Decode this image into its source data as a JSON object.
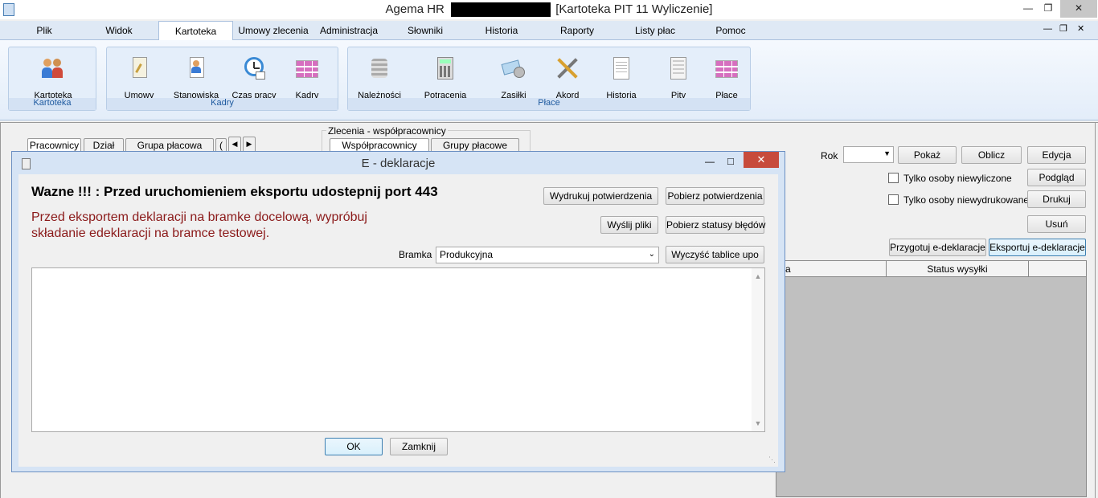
{
  "window": {
    "title": "Agema HR              [Kartoteka PIT 11 Wyliczenie]",
    "title_prefix": "Agema HR",
    "title_suffix": "[Kartoteka PIT 11 Wyliczenie]"
  },
  "menu": {
    "tabs": [
      "Plik",
      "Widok",
      "Kartoteka",
      "Umowy zlecenia",
      "Administracja",
      "Słowniki",
      "Historia",
      "Raporty",
      "Listy płac",
      "Pomoc"
    ],
    "active": "Kartoteka"
  },
  "ribbon": {
    "groups": [
      {
        "label": "Kartoteka",
        "buttons": [
          {
            "label": "Kartoteka",
            "icon": "people-icon"
          }
        ]
      },
      {
        "label": "Kadry",
        "buttons": [
          {
            "label": "Umowy",
            "icon": "contract-icon"
          },
          {
            "label": "Stanowiska",
            "icon": "person-doc-icon"
          },
          {
            "label": "Czas pracy",
            "icon": "clock-icon"
          },
          {
            "label": "Kadry",
            "icon": "grid-icon"
          }
        ]
      },
      {
        "label": "Płace",
        "buttons": [
          {
            "label": "Należności",
            "icon": "coins-icon"
          },
          {
            "label": "Potrącenia",
            "icon": "calculator-icon"
          },
          {
            "label": "Zasiłki",
            "icon": "money-icon"
          },
          {
            "label": "Akord",
            "icon": "tools-icon"
          },
          {
            "label": "Historia",
            "icon": "document-icon"
          },
          {
            "label": "Pity",
            "icon": "form-icon"
          },
          {
            "label": "Płace",
            "icon": "grid-icon"
          }
        ]
      }
    ]
  },
  "background": {
    "left_tabs": [
      "Pracownicy",
      "Dział",
      "Grupa płacowa",
      "("
    ],
    "zlecenia_group": "Zlecenia - współpracownicy",
    "zlecenia_tabs": [
      "Współpracownicy",
      "Grupy płacowe"
    ],
    "rok_label": "Rok",
    "buttons": {
      "pokaz": "Pokaż",
      "oblicz": "Oblicz",
      "edycja": "Edycja",
      "podglad": "Podgląd",
      "drukuj": "Drukuj",
      "usun": "Usuń",
      "przygotuj": "Przygotuj e-deklaracje",
      "eksportuj": "Eksportuj e-deklaracje"
    },
    "checkboxes": {
      "niewyliczone": "Tylko osoby niewyliczone",
      "niewydrukowane": "Tylko osoby niewydrukowane"
    },
    "grid_columns": [
      "a",
      "Status wysyłki"
    ]
  },
  "dialog": {
    "title": "E - deklaracje",
    "heading": "Wazne !!! : Przed uruchomieniem eksportu udostepnij port 443",
    "warning": "Przed eksportem deklaracji na bramke docelową, wypróbuj składanie edeklaracji na bramce testowej.",
    "bramka_label": "Bramka",
    "bramka_value": "Produkcyjna",
    "buttons": {
      "wydrukuj": "Wydrukuj potwierdzenia",
      "pobierz": "Pobierz potwierdzenia",
      "wyslij": "Wyślij pliki",
      "statusy": "Pobierz statusy błędów",
      "wyczysc": "Wyczyść tablice upo",
      "ok": "OK",
      "zamknij": "Zamknij"
    }
  }
}
